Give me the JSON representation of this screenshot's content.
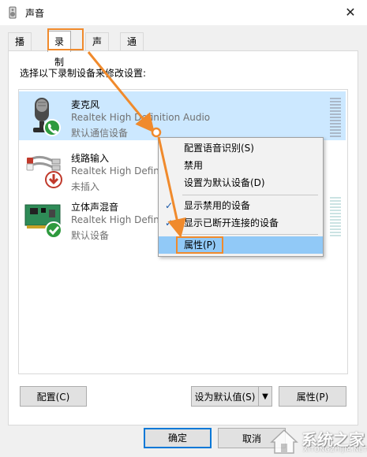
{
  "window": {
    "title": "声音",
    "close_glyph": "✕"
  },
  "tabs": [
    {
      "label": "播放"
    },
    {
      "label": "录制"
    },
    {
      "label": "声音"
    },
    {
      "label": "通信"
    }
  ],
  "instruction": "选择以下录制设备来修改设置:",
  "devices": [
    {
      "name": "麦克风",
      "desc": "Realtek High Definition Audio",
      "status": "默认通信设备",
      "icon": "microphone-icon",
      "badge": "phone-badge"
    },
    {
      "name": "线路输入",
      "desc": "Realtek High Defin",
      "status": "未插入",
      "icon": "line-in-icon",
      "badge": "down-arrow-badge"
    },
    {
      "name": "立体声混音",
      "desc": "Realtek High Defin",
      "status": "默认设备",
      "icon": "sound-card-icon",
      "badge": "check-badge"
    }
  ],
  "context_menu": {
    "items": [
      {
        "label": "配置语音识别(S)",
        "checked": false
      },
      {
        "label": "禁用",
        "checked": false
      },
      {
        "label": "设置为默认设备(D)",
        "checked": false
      },
      {
        "label": "显示禁用的设备",
        "checked": true
      },
      {
        "label": "显示已断开连接的设备",
        "checked": true
      },
      {
        "label": "属性(P)",
        "checked": false
      }
    ],
    "check_glyph": "✓"
  },
  "buttons": {
    "configure": "配置(C)",
    "set_default": "设为默认值(S)",
    "set_default_arrow": "▼",
    "properties": "属性(P)",
    "ok": "确定",
    "cancel": "取消"
  },
  "watermark": {
    "text": "系统之家",
    "url": "XITONGZHIJIA.NET"
  },
  "colors": {
    "selection": "#cce8ff",
    "menu_hover": "#91c9f7",
    "annotation": "#f08a2c",
    "default_button_border": "#0078d7"
  }
}
